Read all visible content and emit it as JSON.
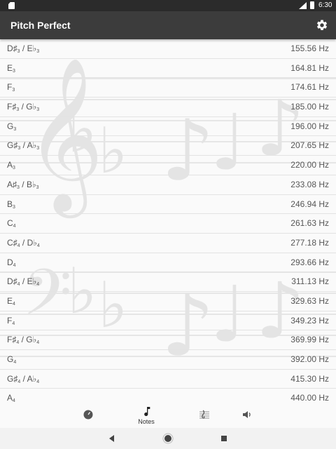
{
  "status_bar": {
    "time": "6:30"
  },
  "app_bar": {
    "title": "Pitch Perfect",
    "settings_icon": "gear-icon"
  },
  "notes": [
    {
      "letter": "D♯",
      "octave": "3",
      "alt_letter": "E♭",
      "alt_octave": "3",
      "freq": "155.56 Hz"
    },
    {
      "letter": "E",
      "octave": "3",
      "alt_letter": "",
      "alt_octave": "",
      "freq": "164.81 Hz"
    },
    {
      "letter": "F",
      "octave": "3",
      "alt_letter": "",
      "alt_octave": "",
      "freq": "174.61 Hz"
    },
    {
      "letter": "F♯",
      "octave": "3",
      "alt_letter": "G♭",
      "alt_octave": "3",
      "freq": "185.00 Hz"
    },
    {
      "letter": "G",
      "octave": "3",
      "alt_letter": "",
      "alt_octave": "",
      "freq": "196.00 Hz"
    },
    {
      "letter": "G♯",
      "octave": "3",
      "alt_letter": "A♭",
      "alt_octave": "3",
      "freq": "207.65 Hz"
    },
    {
      "letter": "A",
      "octave": "3",
      "alt_letter": "",
      "alt_octave": "",
      "freq": "220.00 Hz"
    },
    {
      "letter": "A♯",
      "octave": "3",
      "alt_letter": "B♭",
      "alt_octave": "3",
      "freq": "233.08 Hz"
    },
    {
      "letter": "B",
      "octave": "3",
      "alt_letter": "",
      "alt_octave": "",
      "freq": "246.94 Hz"
    },
    {
      "letter": "C",
      "octave": "4",
      "alt_letter": "",
      "alt_octave": "",
      "freq": "261.63 Hz"
    },
    {
      "letter": "C♯",
      "octave": "4",
      "alt_letter": "D♭",
      "alt_octave": "4",
      "freq": "277.18 Hz"
    },
    {
      "letter": "D",
      "octave": "4",
      "alt_letter": "",
      "alt_octave": "",
      "freq": "293.66 Hz"
    },
    {
      "letter": "D♯",
      "octave": "4",
      "alt_letter": "E♭",
      "alt_octave": "4",
      "freq": "311.13 Hz"
    },
    {
      "letter": "E",
      "octave": "4",
      "alt_letter": "",
      "alt_octave": "",
      "freq": "329.63 Hz"
    },
    {
      "letter": "F",
      "octave": "4",
      "alt_letter": "",
      "alt_octave": "",
      "freq": "349.23 Hz"
    },
    {
      "letter": "F♯",
      "octave": "4",
      "alt_letter": "G♭",
      "alt_octave": "4",
      "freq": "369.99 Hz"
    },
    {
      "letter": "G",
      "octave": "4",
      "alt_letter": "",
      "alt_octave": "",
      "freq": "392.00 Hz"
    },
    {
      "letter": "G♯",
      "octave": "4",
      "alt_letter": "A♭",
      "alt_octave": "4",
      "freq": "415.30 Hz"
    },
    {
      "letter": "A",
      "octave": "4",
      "alt_letter": "",
      "alt_octave": "",
      "freq": "440.00 Hz"
    }
  ],
  "bottom_nav": {
    "items": [
      {
        "icon": "tuner-dial-icon",
        "label": ""
      },
      {
        "icon": "music-note-icon",
        "label": "Notes",
        "selected": true
      },
      {
        "icon": "sheet-music-icon",
        "label": ""
      },
      {
        "icon": "speaker-icon",
        "label": ""
      }
    ]
  },
  "system_nav": {
    "back_icon": "back-triangle-icon",
    "home_icon": "home-circle-icon",
    "recents_icon": "recents-square-icon"
  }
}
